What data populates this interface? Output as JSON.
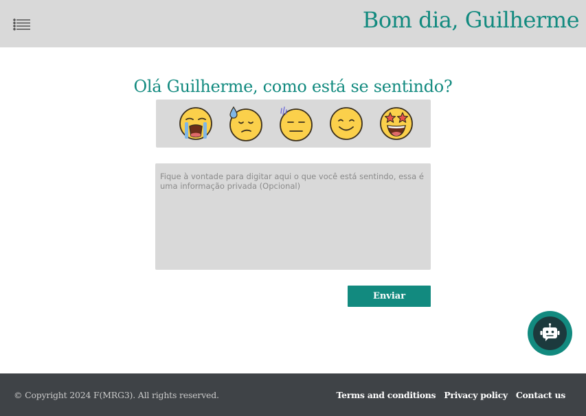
{
  "header": {
    "menu_icon": "list-menu-icon",
    "greeting": "Bom dia, Guilherme"
  },
  "main": {
    "question": "Olá Guilherme, como está se sentindo?",
    "moods": [
      {
        "icon": "loudly-crying-face-icon"
      },
      {
        "icon": "sad-sweat-face-icon"
      },
      {
        "icon": "expressionless-face-icon"
      },
      {
        "icon": "smiling-face-icon"
      },
      {
        "icon": "star-struck-face-icon"
      }
    ],
    "feeling_field": {
      "value": "",
      "placeholder": "Fique à vontade para digitar aqui o que você está sentindo, essa é uma informação privada (Opcional)"
    },
    "send_label": "Enviar"
  },
  "chatbot": {
    "icon": "robot-icon"
  },
  "footer": {
    "copyright": "© Copyright 2024 F(MRG3).  All rights reserved.",
    "links": [
      {
        "label": "Terms and conditions"
      },
      {
        "label": "Privacy policy"
      },
      {
        "label": "Contact us"
      }
    ]
  },
  "colors": {
    "accent": "#128a7f",
    "header_bg": "#d9d9d9",
    "footer_bg": "#3f4347",
    "emoji_yellow": "#fbd04b"
  }
}
